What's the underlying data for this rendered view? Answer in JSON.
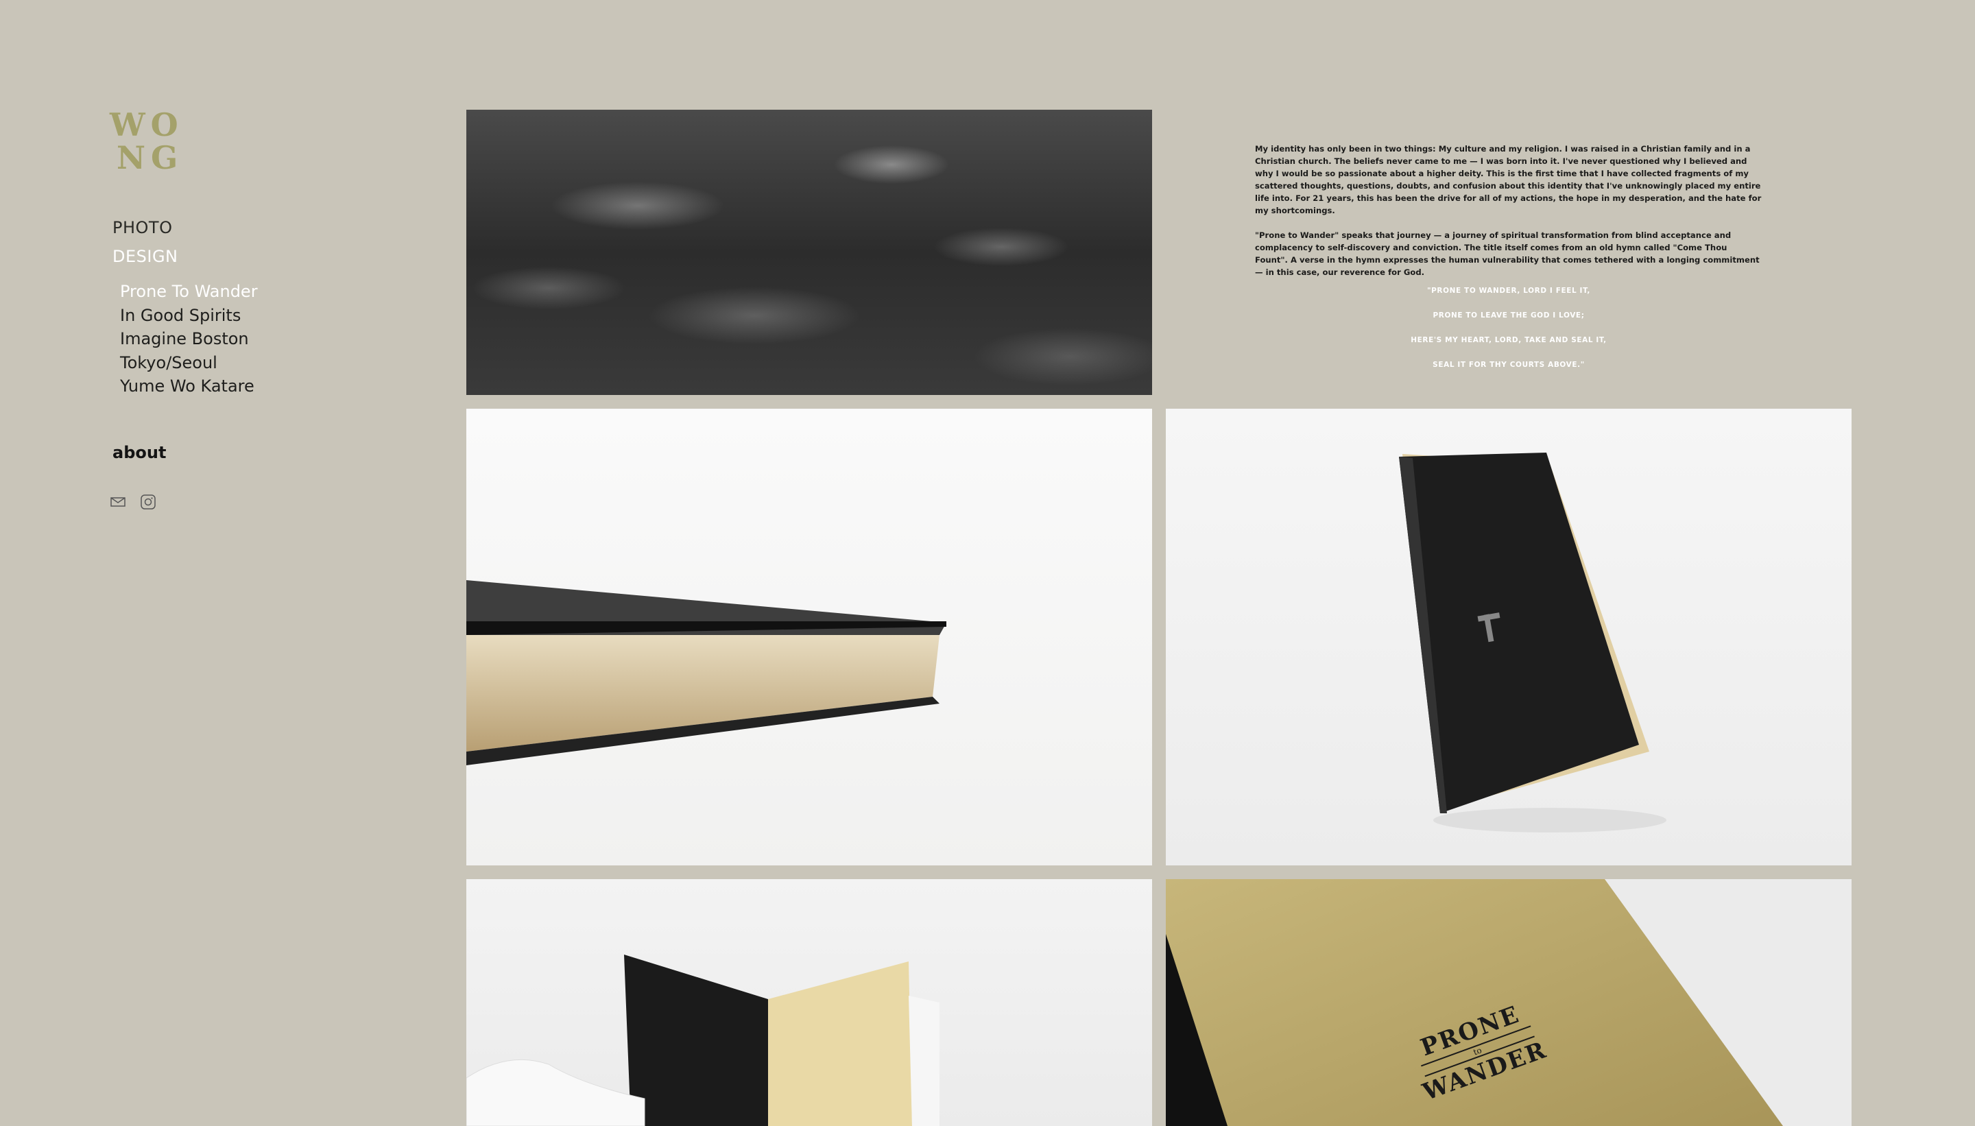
{
  "logo": {
    "line1": "WO",
    "line2": "NG"
  },
  "nav": {
    "photo": "PHOTO",
    "design": "DESIGN",
    "projects": [
      {
        "label": "Prone To Wander",
        "active": true
      },
      {
        "label": "In Good Spirits",
        "active": false
      },
      {
        "label": "Imagine Boston",
        "active": false
      },
      {
        "label": "Tokyo/Seoul",
        "active": false
      },
      {
        "label": "Yume Wo Katare",
        "active": false
      }
    ],
    "about": "about"
  },
  "social": {
    "icons": [
      "mail-icon",
      "instagram-icon"
    ]
  },
  "project": {
    "paragraph1": "My identity has only been in two things: My culture and my religion. I was raised in a Christian family and in a Christian church. The beliefs never came to me — I was born into it. I've never questioned why I believed and why I would be so passionate about a higher deity. This is the first time that I have collected fragments of my scattered thoughts, questions, doubts, and confusion about this identity that I've unknowingly placed my entire life into. For 21 years, this has been the drive for all of my actions, the hope in my desperation, and the hate for my shortcomings.",
    "paragraph2": "\"Prone to Wander\" speaks that journey — a journey of spiritual transformation from blind acceptance and complacency to self-discovery and conviction. The title itself comes from an old hymn called \"Come Thou Fount\". A verse in the hymn expresses the human vulnerability that comes tethered with a longing commitment — in this case, our reverence for God.",
    "verse": [
      "\"PRONE TO WANDER, LORD I FEEL IT,",
      "PRONE TO LEAVE THE GOD I LOVE;",
      "HERE'S MY HEART, LORD, TAKE AND SEAL IT,",
      "SEAL IT FOR THY COURTS ABOVE.\""
    ]
  },
  "book_cover_text": {
    "line1": "PRONE",
    "line2": "to",
    "line3": "WANDER"
  },
  "colors": {
    "background": "#c9c5b9",
    "logo": "#a4a16a",
    "active_nav": "#ffffff"
  }
}
